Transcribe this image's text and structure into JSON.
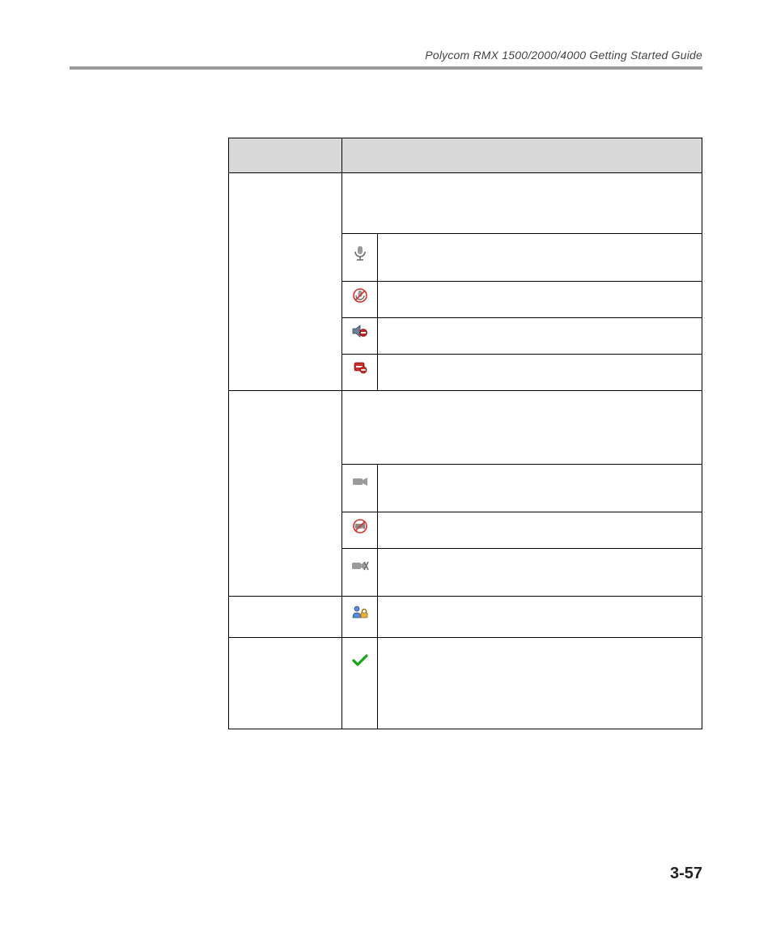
{
  "header": {
    "running_title": "Polycom RMX 1500/2000/4000 Getting Started Guide"
  },
  "footer": {
    "page_number": "3-57"
  },
  "icons": {
    "mic": "microphone-icon",
    "mic_muted": "microphone-muted-icon",
    "speaker_blocked": "speaker-blocked-icon",
    "audio_blocked": "audio-blocked-icon",
    "camera": "camera-icon",
    "camera_muted": "camera-muted-icon",
    "camera_suspended": "camera-suspended-icon",
    "encrypted": "participant-encrypted-icon",
    "fec_ok": "checkmark-icon"
  }
}
